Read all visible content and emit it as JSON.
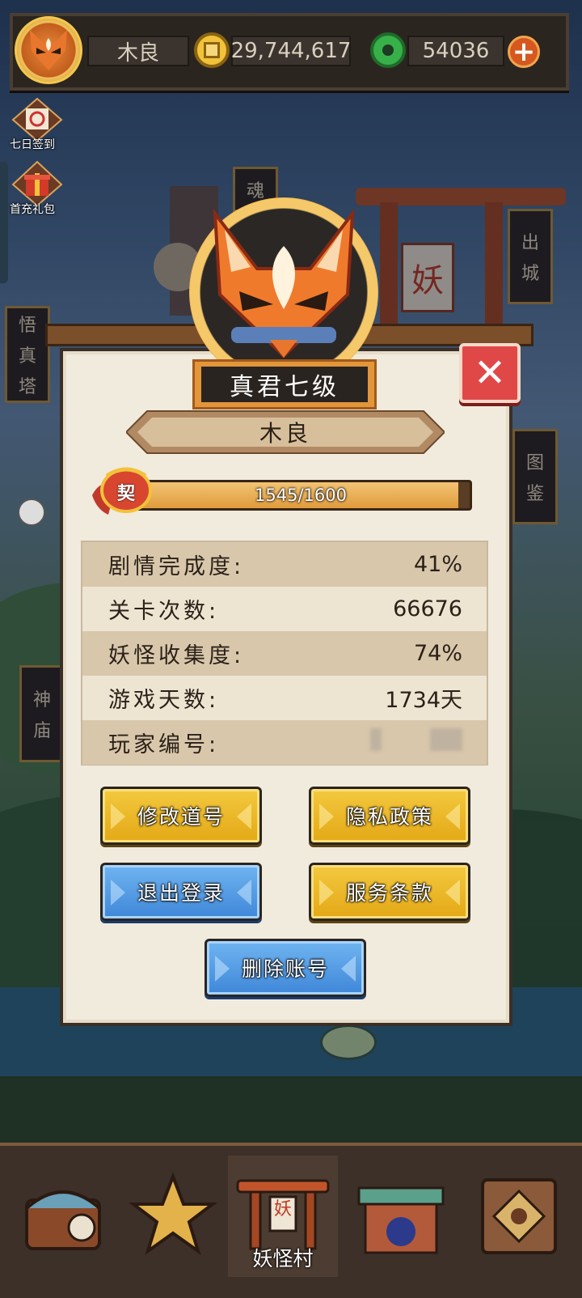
{
  "top_bar": {
    "player_name": "木良",
    "copper_coins": "29,744,617",
    "jade_coins": "54036",
    "add_label": "+"
  },
  "side_menu": {
    "daily_checkin": "七日签到",
    "first_recharge": "首充礼包"
  },
  "map_signs": {
    "soul": "魂",
    "exit_city": [
      "出",
      "城"
    ],
    "wuzhen_tower": [
      "悟",
      "真",
      "塔"
    ],
    "atlas": [
      "图",
      "鉴"
    ],
    "temple": [
      "神",
      "庙"
    ],
    "gate_banner": "妖"
  },
  "profile_dialog": {
    "rank_title": "真君七级",
    "player_name": "木良",
    "contract_badge": "契",
    "xp": {
      "current": 1545,
      "max": 1600,
      "text": "1545/1600"
    },
    "stats": [
      {
        "label": "剧情完成度:",
        "value": "41%"
      },
      {
        "label": "关卡次数:",
        "value": "66676"
      },
      {
        "label": "妖怪收集度:",
        "value": "74%"
      },
      {
        "label": "游戏天数:",
        "value": "1734天"
      },
      {
        "label": "玩家编号:",
        "value": ""
      }
    ],
    "buttons": {
      "change_name": "修改道号",
      "privacy_policy": "隐私政策",
      "logout": "退出登录",
      "terms_of_service": "服务条款",
      "delete_account": "删除账号"
    },
    "close_label": "✕"
  },
  "bottom_nav": {
    "active_label": "妖怪村",
    "active_banner": "妖"
  },
  "colors": {
    "panel": "#f1ebde",
    "stat_stripe": "#d8c7ab",
    "button_yellow": "#e3a816",
    "button_blue": "#3f86d8",
    "close_red": "#e04848"
  }
}
